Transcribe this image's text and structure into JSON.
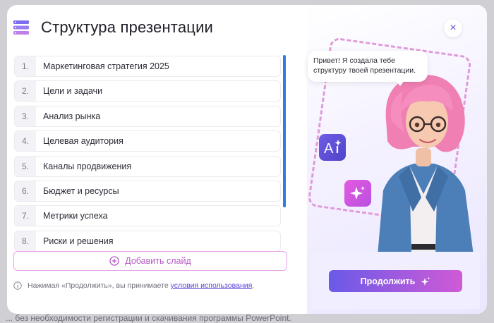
{
  "modal": {
    "title": "Структура презентации",
    "close_label": "×"
  },
  "slides": [
    {
      "num": "1.",
      "label": "Маркетинговая стратегия 2025"
    },
    {
      "num": "2.",
      "label": "Цели и задачи"
    },
    {
      "num": "3.",
      "label": "Анализ рынка"
    },
    {
      "num": "4.",
      "label": "Целевая аудитория"
    },
    {
      "num": "5.",
      "label": "Каналы продвижения"
    },
    {
      "num": "6.",
      "label": "Бюджет и ресурсы"
    },
    {
      "num": "7.",
      "label": "Метрики успеха"
    },
    {
      "num": "8.",
      "label": "Риски и решения"
    }
  ],
  "add_slide_label": "Добавить слайд",
  "terms": {
    "text": "Нажимая «Продолжить», вы принимаете",
    "link": "условия использования",
    "suffix": "."
  },
  "assistant": {
    "bubble_text": "Привет! Я создала тебе структуру твоей презентации.",
    "ai_badge_text": "A"
  },
  "continue_label": "Продолжить",
  "backdrop_text": "... без необходимости регистрации и скачивания программы PowerPoint.",
  "colors": {
    "accent": "#6a5ae8",
    "accent_pink": "#d05ad6",
    "scrollbar": "#2f7de1",
    "link": "#5b3fd6"
  },
  "icons": {
    "title": "slides-stack-icon",
    "close": "close-icon",
    "add": "plus-circle-icon",
    "info": "info-icon",
    "ai": "ai-sparkle-icon",
    "sparkle": "sparkle-icon"
  }
}
